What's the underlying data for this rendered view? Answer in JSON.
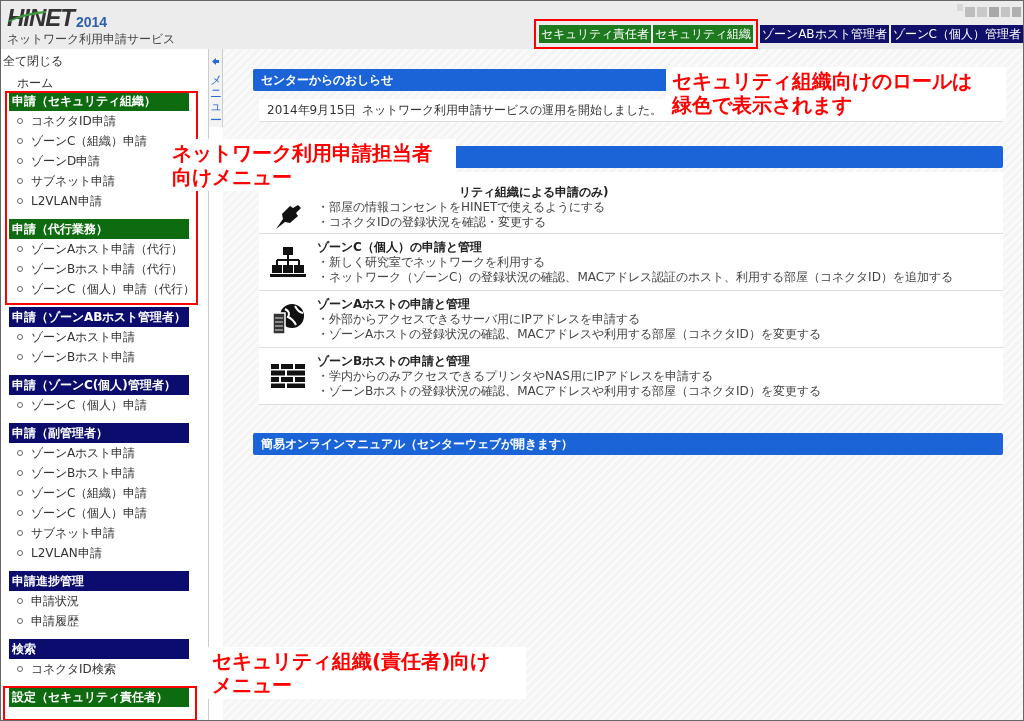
{
  "header": {
    "logo": "HINET",
    "logo_year": "2014",
    "subtitle": "ネットワーク利用申請サービス",
    "roles": [
      {
        "label": "セキュリティ責任者",
        "color": "#1e7a1e"
      },
      {
        "label": "セキュリティ組織",
        "color": "#1e7a1e"
      },
      {
        "label": "ゾーンABホスト管理者",
        "color": "#10106a"
      },
      {
        "label": "ゾーンC（個人）管理者",
        "color": "#10106a"
      }
    ]
  },
  "sidebar": {
    "collapse_all": "全て閉じる",
    "home": "ホーム",
    "groups": [
      {
        "title": "申請（セキュリティ組織）",
        "color": "#0f6b0f",
        "items": [
          "コネクタID申請",
          "ゾーンC（組織）申請",
          "ゾーンD申請",
          "サブネット申請",
          "L2VLAN申請"
        ]
      },
      {
        "title": "申請（代行業務）",
        "color": "#0f6b0f",
        "items": [
          "ゾーンAホスト申請（代行）",
          "ゾーンBホスト申請（代行）",
          "ゾーンC（個人）申請（代行）"
        ]
      },
      {
        "title": "申請（ゾーンABホスト管理者）",
        "color": "#0c0c6e",
        "items": [
          "ゾーンAホスト申請",
          "ゾーンBホスト申請"
        ]
      },
      {
        "title": "申請（ゾーンC(個人)管理者）",
        "color": "#0c0c6e",
        "items": [
          "ゾーンC（個人）申請"
        ]
      },
      {
        "title": "申請（副管理者）",
        "color": "#0c0c6e",
        "items": [
          "ゾーンAホスト申請",
          "ゾーンBホスト申請",
          "ゾーンC（組織）申請",
          "ゾーンC（個人）申請",
          "サブネット申請",
          "L2VLAN申請"
        ]
      },
      {
        "title": "申請進捗管理",
        "color": "#0c0c6e",
        "items": [
          "申請状況",
          "申請履歴"
        ]
      },
      {
        "title": "検索",
        "color": "#0c0c6e",
        "items": [
          "コネクタID検索"
        ]
      },
      {
        "title": "設定（セキュリティ責任者）",
        "color": "#0f6b0f"
      }
    ]
  },
  "side_tab": {
    "label": "メニュー"
  },
  "notices": {
    "title": "センターからのおしらせ",
    "rows": [
      {
        "date": "2014年9月15日",
        "text": "ネットワーク利用申請サービスの運用を開始しました。"
      }
    ]
  },
  "services": {
    "items": [
      {
        "kind": "plug",
        "title": "リティ組織による申請のみ)",
        "lines": [
          "・部屋の情報コンセントをHINETで使えるようにする",
          "・コネクタIDの登録状況を確認・変更する"
        ]
      },
      {
        "kind": "network",
        "title": "ゾーンC（個人）の申請と管理",
        "lines": [
          "・新しく研究室でネットワークを利用する",
          "・ネットワーク（ゾーンC）の登録状況の確認、MACアドレス認証のホスト、利用する部屋（コネクタID）を追加する"
        ]
      },
      {
        "kind": "server",
        "title": "ゾーンAホストの申請と管理",
        "lines": [
          "・外部からアクセスできるサーバ用にIPアドレスを申請する",
          "・ゾーンAホストの登録状況の確認、MACアドレスや利用する部屋（コネクタID）を変更する"
        ]
      },
      {
        "kind": "firewall",
        "title": "ゾーンBホストの申請と管理",
        "lines": [
          "・学内からのみアクセスできるプリンタやNAS用にIPアドレスを申請する",
          "・ゾーンBホストの登録状況の確認、MACアドレスや利用する部屋（コネクタID）を変更する"
        ]
      }
    ]
  },
  "manual": {
    "title": "簡易オンラインマニュアル（センターウェブが開きます）"
  },
  "annotations": [
    {
      "lines": [
        "セキュリティ組織向けのロールは",
        "緑色で表示されます"
      ]
    },
    {
      "lines": [
        "ネットワーク利用申請担当者",
        "向けメニュー"
      ]
    },
    {
      "lines": [
        "セキュリティ組織(責任者)向け",
        "メニュー"
      ]
    }
  ]
}
